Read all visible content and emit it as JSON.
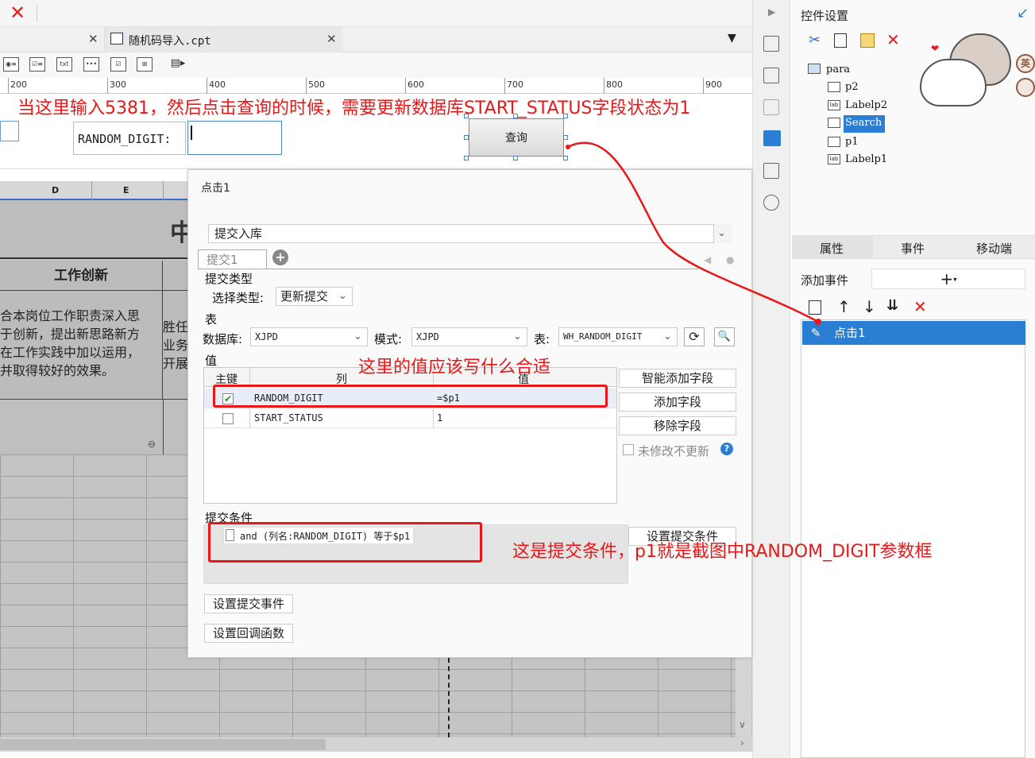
{
  "window": {
    "close_icon": "close-icon"
  },
  "tabs": [
    {
      "label": ""
    },
    {
      "label": "随机码导入.cpt"
    }
  ],
  "ruler": {
    "ticks": [
      "200",
      "300",
      "400",
      "500",
      "600",
      "700",
      "800",
      "900"
    ]
  },
  "params": {
    "random_digit_label": "RANDOM_DIGIT:",
    "random_digit_value": "",
    "query_button": "查询"
  },
  "sheet": {
    "col_headers": [
      "D",
      "E"
    ],
    "banner_char": "中",
    "heading": "工作创新",
    "body_lines": "合本岗位工作职责深入思\n于创新，提出新思路新方\n在工作实践中加以运用，\n并取得较好的效果。",
    "right_lines": "胜任\n业务\n开展"
  },
  "dialog": {
    "title": "点击1",
    "action": "提交入库",
    "subtab": "提交1",
    "submit_type_section": "提交类型",
    "select_type_label": "选择类型:",
    "select_type_value": "更新提交",
    "table_section": "表",
    "database_label": "数据库:",
    "database_value": "XJPD",
    "schema_label": "模式:",
    "schema_value": "XJPD",
    "table_label": "表:",
    "table_value": "WH_RANDOM_DIGIT",
    "value_section": "值",
    "columns": {
      "key": "主键",
      "col": "列",
      "val": "值"
    },
    "rows": [
      {
        "key_checked": true,
        "column": "RANDOM_DIGIT",
        "value": "=$p1"
      },
      {
        "key_checked": false,
        "column": "START_STATUS",
        "value": "1"
      }
    ],
    "buttons": {
      "smart_add": "智能添加字段",
      "add_field": "添加字段",
      "remove_field": "移除字段",
      "no_update_unmodified": "未修改不更新",
      "set_condition": "设置提交条件",
      "set_submit_event": "设置提交事件",
      "set_callback": "设置回调函数"
    },
    "condition_section": "提交条件",
    "condition_item": "and (列名:RANDOM_DIGIT) 等于$p1"
  },
  "right_panel": {
    "title": "控件设置",
    "tree": [
      {
        "label": "para",
        "icon": "form-icon"
      },
      {
        "label": "p2",
        "icon": "textbox-icon"
      },
      {
        "label": "Labelp2",
        "icon": "label-icon"
      },
      {
        "label": "Search",
        "icon": "search-button-icon",
        "selected": true
      },
      {
        "label": "p1",
        "icon": "textbox-icon"
      },
      {
        "label": "Labelp1",
        "icon": "label-icon"
      }
    ],
    "tabs": [
      "属性",
      "事件",
      "移动端"
    ],
    "add_event_label": "添加事件",
    "event_item": "点击1",
    "mascot_badges": [
      "英",
      ""
    ]
  },
  "annotations": {
    "top": "当这里输入5381，然后点击查询的时候，需要更新数据库START_STATUS字段状态为1",
    "value_question": "这里的值应该写什么合适",
    "condition_note": "这是提交条件，p1就是截图中RANDOM_DIGIT参数框"
  },
  "colors": {
    "annotation_red": "#e81818",
    "selection_blue": "#2a7fd4"
  }
}
